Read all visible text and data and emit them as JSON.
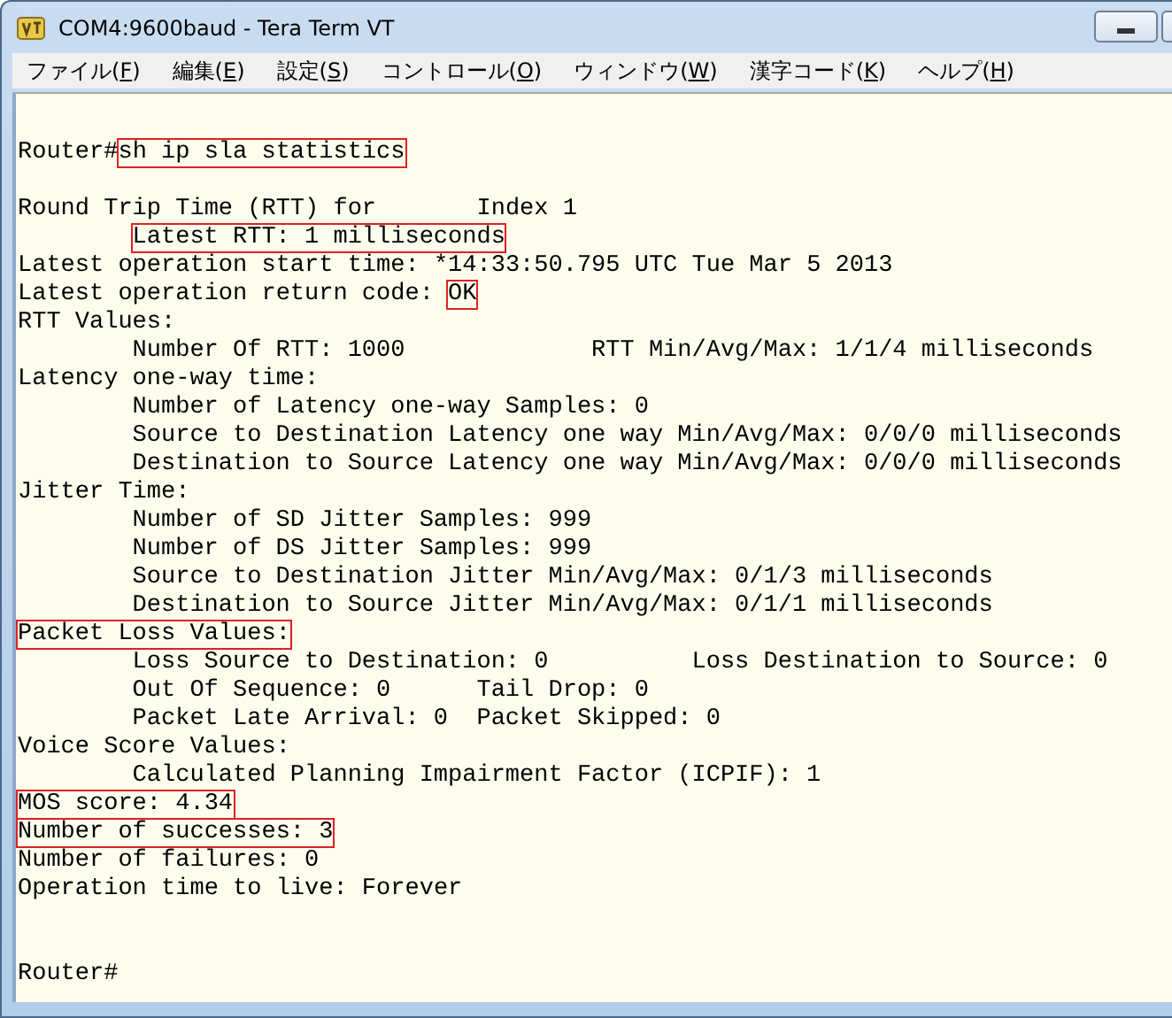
{
  "window": {
    "title": "COM4:9600baud - Tera Term VT"
  },
  "menu": [
    {
      "prefix": "ファイル(",
      "accesskey": "F",
      "suffix": ")"
    },
    {
      "prefix": "編集(",
      "accesskey": "E",
      "suffix": ")"
    },
    {
      "prefix": "設定(",
      "accesskey": "S",
      "suffix": ")"
    },
    {
      "prefix": "コントロール(",
      "accesskey": "O",
      "suffix": ")"
    },
    {
      "prefix": "ウィンドウ(",
      "accesskey": "W",
      "suffix": ")"
    },
    {
      "prefix": "漢字コード(",
      "accesskey": "K",
      "suffix": ")"
    },
    {
      "prefix": "ヘルプ(",
      "accesskey": "H",
      "suffix": ")"
    }
  ],
  "terminal": {
    "lines": [
      {
        "kind": "text",
        "segments": [
          {
            "text": "Router#",
            "boxed": false
          },
          {
            "text": "sh ip sla statistics",
            "boxed": true
          }
        ]
      },
      {
        "kind": "blank"
      },
      {
        "kind": "text",
        "segments": [
          {
            "text": "Round Trip Time (RTT) for       Index 1",
            "boxed": false
          }
        ]
      },
      {
        "kind": "text",
        "indented": true,
        "segments": [
          {
            "text": "Latest RTT: 1 milliseconds",
            "boxed": true
          }
        ]
      },
      {
        "kind": "text",
        "segments": [
          {
            "text": "Latest operation start time: *14:33:50.795 UTC Tue Mar 5 2013",
            "boxed": false
          }
        ]
      },
      {
        "kind": "text",
        "segments": [
          {
            "text": "Latest operation return code: ",
            "boxed": false
          },
          {
            "text": "OK",
            "boxed": true
          }
        ]
      },
      {
        "kind": "text",
        "segments": [
          {
            "text": "RTT Values:",
            "boxed": false
          }
        ]
      },
      {
        "kind": "text",
        "indented": true,
        "segments": [
          {
            "text": "Number Of RTT: 1000             RTT Min/Avg/Max: 1/1/4 milliseconds",
            "boxed": false
          }
        ]
      },
      {
        "kind": "text",
        "segments": [
          {
            "text": "Latency one-way time:",
            "boxed": false
          }
        ]
      },
      {
        "kind": "text",
        "indented": true,
        "segments": [
          {
            "text": "Number of Latency one-way Samples: 0",
            "boxed": false
          }
        ]
      },
      {
        "kind": "text",
        "indented": true,
        "segments": [
          {
            "text": "Source to Destination Latency one way Min/Avg/Max: 0/0/0 milliseconds",
            "boxed": false
          }
        ]
      },
      {
        "kind": "text",
        "indented": true,
        "segments": [
          {
            "text": "Destination to Source Latency one way Min/Avg/Max: 0/0/0 milliseconds",
            "boxed": false
          }
        ]
      },
      {
        "kind": "text",
        "segments": [
          {
            "text": "Jitter Time:",
            "boxed": false
          }
        ]
      },
      {
        "kind": "text",
        "indented": true,
        "segments": [
          {
            "text": "Number of SD Jitter Samples: 999",
            "boxed": false
          }
        ]
      },
      {
        "kind": "text",
        "indented": true,
        "segments": [
          {
            "text": "Number of DS Jitter Samples: 999",
            "boxed": false
          }
        ]
      },
      {
        "kind": "text",
        "indented": true,
        "segments": [
          {
            "text": "Source to Destination Jitter Min/Avg/Max: 0/1/3 milliseconds",
            "boxed": false
          }
        ]
      },
      {
        "kind": "text",
        "indented": true,
        "segments": [
          {
            "text": "Destination to Source Jitter Min/Avg/Max: 0/1/1 milliseconds",
            "boxed": false
          }
        ]
      },
      {
        "kind": "text",
        "segments": [
          {
            "text": "Packet Loss Values:",
            "boxed": true
          }
        ]
      },
      {
        "kind": "text",
        "indented": true,
        "segments": [
          {
            "text": "Loss Source to Destination: 0          Loss Destination to Source: 0",
            "boxed": false
          }
        ]
      },
      {
        "kind": "text",
        "indented": true,
        "segments": [
          {
            "text": "Out Of Sequence: 0      Tail Drop: 0",
            "boxed": false
          }
        ]
      },
      {
        "kind": "text",
        "indented": true,
        "segments": [
          {
            "text": "Packet Late Arrival: 0  Packet Skipped: 0",
            "boxed": false
          }
        ]
      },
      {
        "kind": "text",
        "segments": [
          {
            "text": "Voice Score Values:",
            "boxed": false
          }
        ]
      },
      {
        "kind": "text",
        "indented": true,
        "segments": [
          {
            "text": "Calculated Planning Impairment Factor (ICPIF): 1",
            "boxed": false
          }
        ]
      },
      {
        "kind": "text",
        "segments": [
          {
            "text": "MOS score: 4.34",
            "boxed": true
          }
        ]
      },
      {
        "kind": "text",
        "segments": [
          {
            "text": "Number of successes: 3",
            "boxed": true
          }
        ]
      },
      {
        "kind": "text",
        "segments": [
          {
            "text": "Number of failures: 0",
            "boxed": false
          }
        ]
      },
      {
        "kind": "text",
        "segments": [
          {
            "text": "Operation time to live: Forever",
            "boxed": false
          }
        ]
      },
      {
        "kind": "blank"
      },
      {
        "kind": "blank"
      },
      {
        "kind": "text",
        "segments": [
          {
            "text": "Router#",
            "boxed": false
          }
        ]
      }
    ]
  }
}
